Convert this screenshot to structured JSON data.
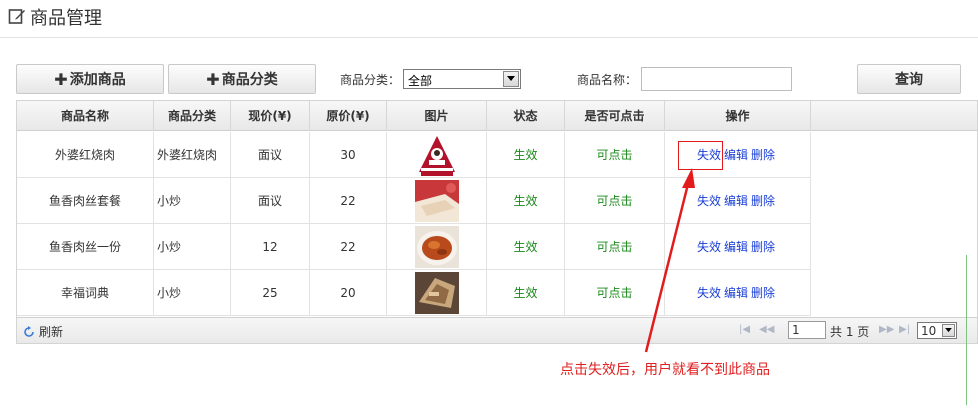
{
  "page": {
    "title": "商品管理",
    "icon": "edit-icon"
  },
  "toolbar": {
    "add_product": "添加商品",
    "product_category": "商品分类",
    "category_label": "商品分类：",
    "category_value": "全部",
    "name_label": "商品名称：",
    "name_value": "",
    "query_button": "查询"
  },
  "table": {
    "columns": [
      "商品名称",
      "商品分类",
      "现价(¥)",
      "原价(¥)",
      "图片",
      "状态",
      "是否可点击",
      "操作"
    ],
    "rows": [
      {
        "name": "外婆红烧肉",
        "category": "外婆红烧肉",
        "price": "面议",
        "original_price": "30",
        "image": "cafe-de-colombia-logo",
        "status": "生效",
        "clickable": "可点击",
        "op_invalidate": "失效",
        "op_edit": "编辑",
        "op_delete": "删除"
      },
      {
        "name": "鱼香肉丝套餐",
        "category": "小炒",
        "price": "面议",
        "original_price": "22",
        "image": "cake-photo",
        "status": "生效",
        "clickable": "可点击",
        "op_invalidate": "失效",
        "op_edit": "编辑",
        "op_delete": "删除"
      },
      {
        "name": "鱼香肉丝一份",
        "category": "小炒",
        "price": "12",
        "original_price": "22",
        "image": "noodle-dish-photo",
        "status": "生效",
        "clickable": "可点击",
        "op_invalidate": "失效",
        "op_edit": "编辑",
        "op_delete": "删除"
      },
      {
        "name": "幸福词典",
        "category": "小炒",
        "price": "25",
        "original_price": "20",
        "image": "food-photo",
        "status": "生效",
        "clickable": "可点击",
        "op_invalidate": "失效",
        "op_edit": "编辑",
        "op_delete": "删除"
      }
    ]
  },
  "pager": {
    "refresh": "刷新",
    "page": "1",
    "total_text": "共 1 页",
    "page_size": "10"
  },
  "annotation": {
    "text": "点击失效后，用户就看不到此商品",
    "color": "#e02020"
  },
  "colors": {
    "status_green": "#1a8a1a",
    "link_blue": "#1a3ed6",
    "annotation_red": "#e02020"
  }
}
